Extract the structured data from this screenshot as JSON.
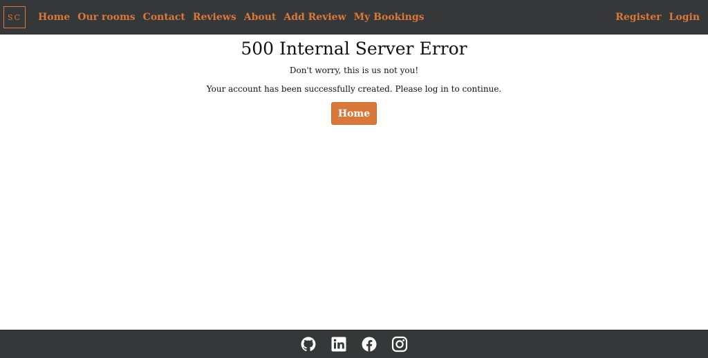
{
  "brand": {
    "logo_text": "SC",
    "accent_color": "#d8783b",
    "nav_bg": "#363738"
  },
  "nav": {
    "left": [
      "Home",
      "Our rooms",
      "Contact",
      "Reviews",
      "About",
      "Add Review",
      "My Bookings"
    ],
    "right": [
      "Register",
      "Login"
    ]
  },
  "main": {
    "title": "500 Internal Server Error",
    "subtitle": "Don't worry, this is us not you!",
    "message": "Your account has been successfully created. Please log in to continue.",
    "home_button": "Home"
  },
  "footer": {
    "icons": [
      "github-icon",
      "linkedin-icon",
      "facebook-icon",
      "instagram-icon"
    ]
  }
}
